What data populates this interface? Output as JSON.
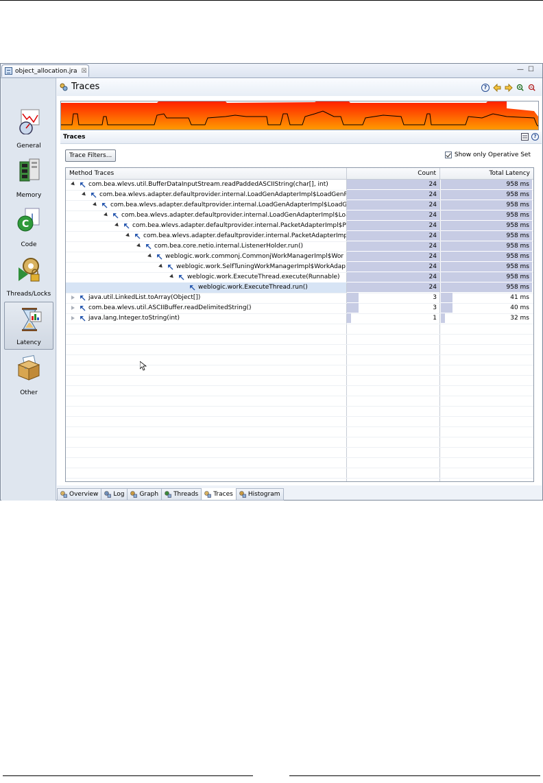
{
  "editor_tab": {
    "title": "object_allocation.jra",
    "close": "☒"
  },
  "window_controls": {
    "minimize": "—",
    "maximize": "☐"
  },
  "nav": [
    {
      "label": "General",
      "icon": "gauge-chart-icon",
      "active": false
    },
    {
      "label": "Memory",
      "icon": "memory-chip-icon",
      "active": false
    },
    {
      "label": "Code",
      "icon": "java-code-icon",
      "active": false
    },
    {
      "label": "Threads/Locks",
      "icon": "gears-lock-icon",
      "active": false
    },
    {
      "label": "Latency",
      "icon": "hourglass-icon",
      "active": true
    },
    {
      "label": "Other",
      "icon": "box-icon",
      "active": false
    }
  ],
  "header": {
    "title": "Traces",
    "icon": "traces-icon",
    "tools": [
      "help-icon",
      "back-arrow-icon",
      "forward-arrow-icon",
      "zoom-in-icon",
      "zoom-out-icon"
    ]
  },
  "overview": {
    "colors": {
      "fill_top": "#ff2200",
      "fill_bottom": "#ff9a00",
      "line": "#000000"
    }
  },
  "section": {
    "title": "Traces",
    "filter_button": "Trace Filters...",
    "checkbox_label": "Show only Operative Set",
    "checkbox_checked": true
  },
  "table": {
    "columns": [
      "Method Traces",
      "Count",
      "Total Latency"
    ],
    "max_count": 24,
    "rows": [
      {
        "depth": 0,
        "expanded": true,
        "name": "com.bea.wlevs.util.BufferDataInputStream.readPaddedASCIIString(char[], int)",
        "count": "24",
        "latency": "958 ms",
        "count_value": 24
      },
      {
        "depth": 1,
        "expanded": true,
        "name": "com.bea.wlevs.adapter.defaultprovider.internal.LoadGenAdapterImpl$LoadGenRe",
        "count": "24",
        "latency": "958 ms",
        "count_value": 24
      },
      {
        "depth": 2,
        "expanded": true,
        "name": "com.bea.wlevs.adapter.defaultprovider.internal.LoadGenAdapterImpl$LoadGe",
        "count": "24",
        "latency": "958 ms",
        "count_value": 24
      },
      {
        "depth": 3,
        "expanded": true,
        "name": "com.bea.wlevs.adapter.defaultprovider.internal.LoadGenAdapterImpl$Loa",
        "count": "24",
        "latency": "958 ms",
        "count_value": 24
      },
      {
        "depth": 4,
        "expanded": true,
        "name": "com.bea.wlevs.adapter.defaultprovider.internal.PacketAdapterImpl$Pa",
        "count": "24",
        "latency": "958 ms",
        "count_value": 24
      },
      {
        "depth": 5,
        "expanded": true,
        "name": "com.bea.wlevs.adapter.defaultprovider.internal.PacketAdapterImp",
        "count": "24",
        "latency": "958 ms",
        "count_value": 24
      },
      {
        "depth": 6,
        "expanded": true,
        "name": "com.bea.core.netio.internal.ListenerHolder.run()",
        "count": "24",
        "latency": "958 ms",
        "count_value": 24
      },
      {
        "depth": 7,
        "expanded": true,
        "name": "weblogic.work.commonj.CommonjWorkManagerImpl$Wor",
        "count": "24",
        "latency": "958 ms",
        "count_value": 24
      },
      {
        "depth": 8,
        "expanded": true,
        "name": "weblogic.work.SelfTuningWorkManagerImpl$WorkAdap",
        "count": "24",
        "latency": "958 ms",
        "count_value": 24
      },
      {
        "depth": 9,
        "expanded": true,
        "name": "weblogic.work.ExecuteThread.execute(Runnable)",
        "count": "24",
        "latency": "958 ms",
        "count_value": 24
      },
      {
        "depth": 10,
        "expanded": null,
        "selected": true,
        "name": "weblogic.work.ExecuteThread.run()",
        "count": "24",
        "latency": "958 ms",
        "count_value": 24
      },
      {
        "depth": 0,
        "expanded": false,
        "name": "java.util.LinkedList.toArray(Object[])",
        "count": "3",
        "latency": "41 ms",
        "count_value": 3
      },
      {
        "depth": 0,
        "expanded": false,
        "name": "com.bea.wlevs.util.ASCIIBuffer.readDelimitedString()",
        "count": "3",
        "latency": "40 ms",
        "count_value": 3
      },
      {
        "depth": 0,
        "expanded": false,
        "name": "java.lang.Integer.toString(int)",
        "count": "1",
        "latency": "32 ms",
        "count_value": 1
      }
    ]
  },
  "bottom_tabs": [
    {
      "label": "Overview",
      "icon": "overview-icon",
      "active": false
    },
    {
      "label": "Log",
      "icon": "log-icon",
      "active": false
    },
    {
      "label": "Graph",
      "icon": "graph-icon",
      "active": false
    },
    {
      "label": "Threads",
      "icon": "threads-icon",
      "active": false
    },
    {
      "label": "Traces",
      "icon": "traces-icon",
      "active": true
    },
    {
      "label": "Histogram",
      "icon": "histogram-icon",
      "active": false
    }
  ]
}
